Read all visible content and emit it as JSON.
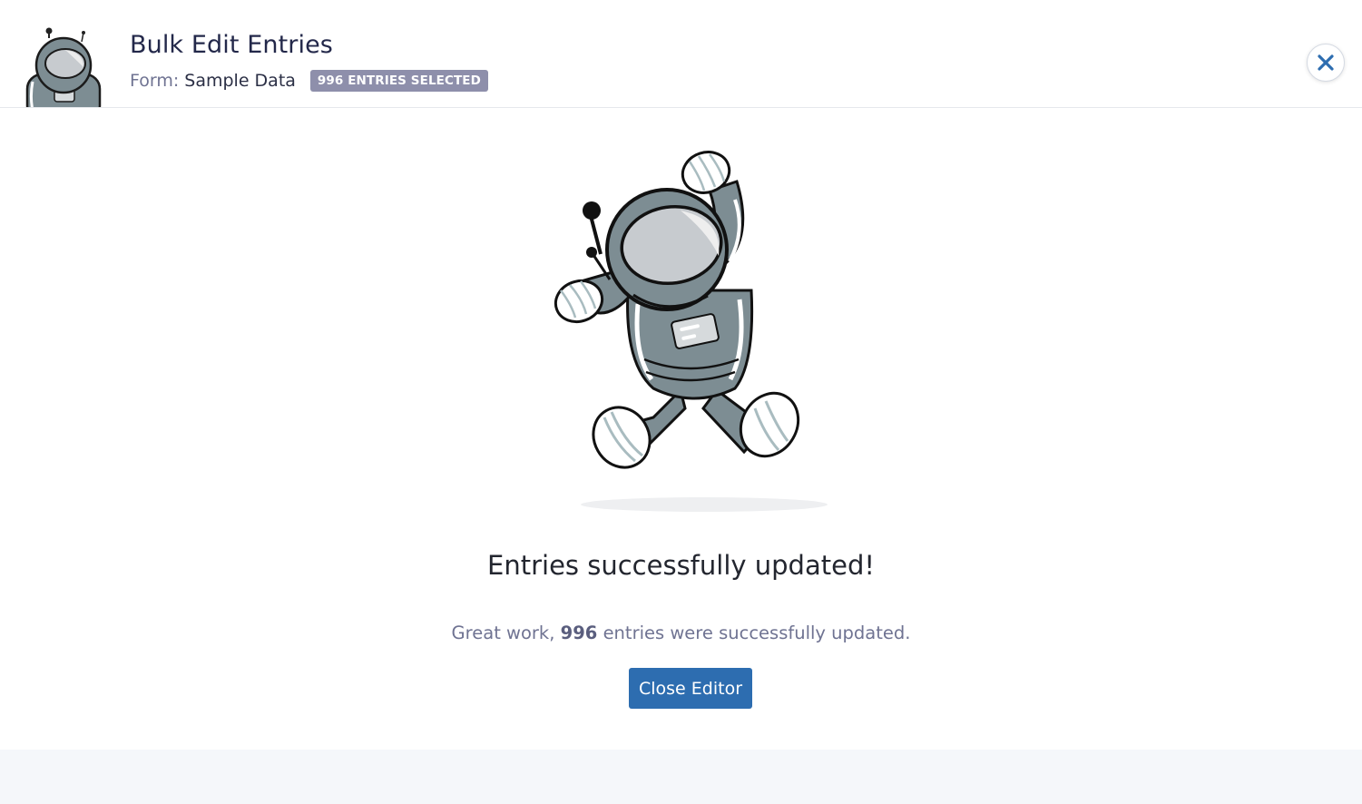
{
  "header": {
    "title": "Bulk Edit Entries",
    "form_label": "Form:",
    "form_name": "Sample Data",
    "badge": "996 ENTRIES SELECTED",
    "close_icon": "close-icon"
  },
  "result": {
    "title": "Entries successfully updated!",
    "message_prefix": "Great work,",
    "count": "996",
    "message_suffix": "entries were successfully updated.",
    "button_label": "Close Editor"
  },
  "colors": {
    "primary_button": "#2d6db0",
    "badge_bg": "#8e8fab",
    "title_text": "#23284a",
    "footer_band": "#f5f7fa"
  }
}
